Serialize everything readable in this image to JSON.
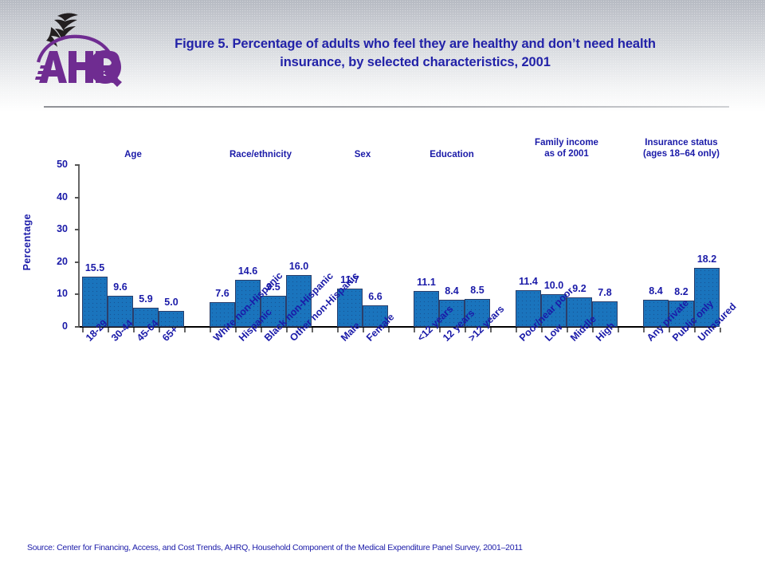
{
  "header": {
    "title": "Figure 5. Percentage of adults who feel they are healthy and don’t need health insurance, by selected characteristics, 2001",
    "logo_alt": "AHRQ",
    "logo_wordmark": "AHRQ",
    "logo_symbol": "hhs-eagle-icon"
  },
  "footer": {
    "source": "Source: Center for Financing, Access, and Cost Trends, AHRQ, Household Component of the Medical Expenditure Panel Survey,  2001–2011"
  },
  "chart_data": {
    "type": "bar",
    "title": "Figure 5. Percentage of adults who feel they are healthy and don’t need health insurance, by selected characteristics, 2001",
    "xlabel": "",
    "ylabel": "Percentage",
    "ylim": [
      0,
      50
    ],
    "yticks": [
      0,
      10,
      20,
      30,
      40,
      50
    ],
    "ytick_labels": [
      "0",
      "10",
      "20",
      "30",
      "40",
      "50"
    ],
    "grid": false,
    "legend": "none",
    "value_label_format": "one-decimal",
    "bar_color": "#1a74bd",
    "bar_edge_color": "#2b3f6b",
    "text_color": "#1a1aa8",
    "categories": [
      "18-29",
      "30-44",
      "45-64",
      "65+",
      "White non-Hispanic",
      "Hispanic",
      "Black non-Hispanic",
      "Other non-Hispanic",
      "Male",
      "Female",
      "<12 years",
      "12 years",
      ">12 years",
      "Poor/near poor",
      "Low",
      "Middle",
      "High",
      "Any private",
      "Public only",
      "Uninsured"
    ],
    "values": [
      15.5,
      9.6,
      5.9,
      5.0,
      7.6,
      14.6,
      9.5,
      16.0,
      11.7,
      6.6,
      11.1,
      8.4,
      8.5,
      11.4,
      10.0,
      9.2,
      7.8,
      8.4,
      8.2,
      18.2
    ],
    "groups": [
      {
        "label": "Age",
        "label_line2": "",
        "categories": [
          "18-29",
          "30-44",
          "45-64",
          "65+"
        ],
        "values": [
          15.5,
          9.6,
          5.9,
          5.0
        ]
      },
      {
        "label": "Race/ethnicity",
        "label_line2": "",
        "categories": [
          "White non-Hispanic",
          "Hispanic",
          "Black non-Hispanic",
          "Other non-Hispanic"
        ],
        "values": [
          7.6,
          14.6,
          9.5,
          16.0
        ]
      },
      {
        "label": "Sex",
        "label_line2": "",
        "categories": [
          "Male",
          "Female"
        ],
        "values": [
          11.7,
          6.6
        ]
      },
      {
        "label": "Education",
        "label_line2": "",
        "categories": [
          "<12 years",
          "12 years",
          ">12 years"
        ],
        "values": [
          11.1,
          8.4,
          8.5
        ]
      },
      {
        "label": "Family income",
        "label_line2": "as of 2001",
        "categories": [
          "Poor/near poor",
          "Low",
          "Middle",
          "High"
        ],
        "values": [
          11.4,
          10.0,
          9.2,
          7.8
        ]
      },
      {
        "label": "Insurance status",
        "label_line2": "(ages 18–64  only)",
        "categories": [
          "Any private",
          "Public only",
          "Uninsured"
        ],
        "values": [
          8.4,
          8.2,
          18.2
        ]
      }
    ]
  }
}
